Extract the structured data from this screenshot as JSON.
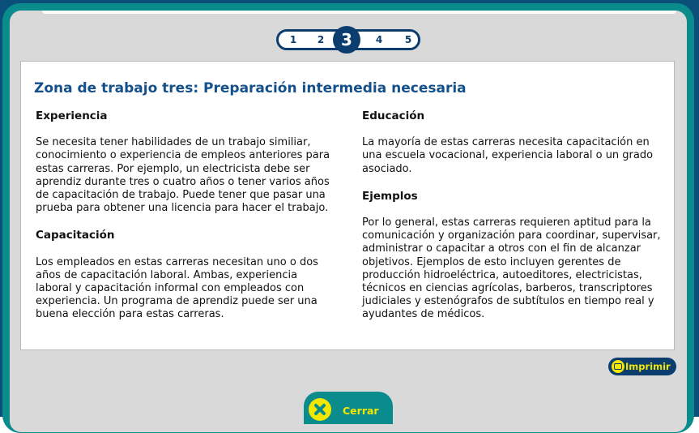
{
  "pager": {
    "pages": [
      "1",
      "2",
      "3",
      "4",
      "5"
    ],
    "current": "3"
  },
  "card": {
    "title": "Zona de trabajo tres: Preparación intermedia necesaria",
    "left": {
      "experiencia_heading": "Experiencia",
      "experiencia_text": "Se necesita tener habilidades de un trabajo similiar, conocimiento o experiencia de empleos anteriores para estas carreras. Por ejemplo, un electricista debe ser aprendiz durante tres o cuatro años o tener varios años de capacitación de trabajo. Puede tener que pasar una prueba para obtener una licencia para hacer el trabajo.",
      "capacitacion_heading": "Capacitación",
      "capacitacion_text": "Los empleados en estas carreras necesitan uno o dos años de capacitación laboral. Ambas, experiencia laboral y capacitación informal con empleados con experiencia. Un programa de aprendiz puede ser una buena elección para estas carreras."
    },
    "right": {
      "educacion_heading": "Educación",
      "educacion_text": "La mayoría de estas carreras necesita capacitación en una escuela vocacional, experiencia laboral o un grado asociado.",
      "ejemplos_heading": "Ejemplos",
      "ejemplos_text": "Por lo general, estas carreras requieren aptitud para la comunicación y organización para coordinar, supervisar, administrar o capacitar a otros con el fin de alcanzar objetivos. Ejemplos de esto incluyen gerentes de producción hidroeléctrica, autoeditores, electricistas, técnicos en ciencias agrícolas, barberos, transcriptores judiciales y estenógrafos de subtítulos en tiempo real y ayudantes de médicos."
    }
  },
  "actions": {
    "print_label": "Imprimir",
    "print_icon": "printer-icon",
    "close_label": "Cerrar",
    "close_icon": "close-x-icon"
  },
  "colors": {
    "teal": "#0b8c8c",
    "navy": "#0b3d6e",
    "title_blue": "#14508a",
    "yellow": "#f3e600",
    "panel_gray": "#d9d9d9"
  }
}
